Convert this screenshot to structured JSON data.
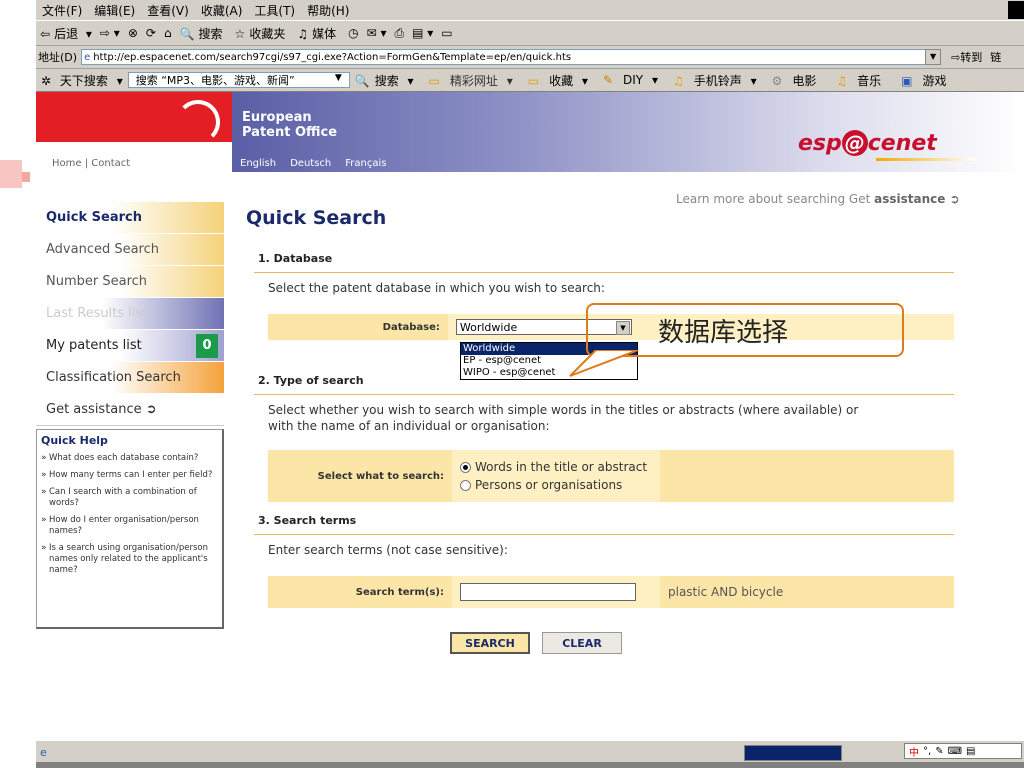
{
  "menubar": {
    "items": [
      "文件(F)",
      "编辑(E)",
      "查看(V)",
      "收藏(A)",
      "工具(T)",
      "帮助(H)"
    ]
  },
  "toolbar": {
    "back": "后退",
    "search": "搜索",
    "favorites": "收藏夹",
    "media": "媒体"
  },
  "address": {
    "label": "地址(D)",
    "url": "http://ep.espacenet.com/search97cgi/s97_cgi.exe?Action=FormGen&Template=ep/en/quick.hts",
    "go": "转到",
    "links": "链"
  },
  "searchbar": {
    "label": "天下搜索",
    "query": "搜索 “MP3、电影、游戏、新闻”",
    "search": "搜索",
    "sites": "精彩网址",
    "favorites": "收藏",
    "diy": "DIY",
    "ringtones": "手机铃声",
    "movies": "电影",
    "music": "音乐",
    "games": "游戏"
  },
  "header": {
    "org_line1": "European",
    "org_line2": "Patent Office",
    "home_links": "Home | Contact",
    "langs": [
      "English",
      "Deutsch",
      "Français"
    ],
    "logo_pre": "esp",
    "logo_at": "@",
    "logo_post": "cenet"
  },
  "sidebar": {
    "items": [
      {
        "label": "Quick Search"
      },
      {
        "label": "Advanced Search"
      },
      {
        "label": "Number Search"
      },
      {
        "label": "Last Results list"
      },
      {
        "label": "My patents list",
        "badge": "0"
      },
      {
        "label": "Classification Search"
      },
      {
        "label": "Get assistance ➲"
      }
    ],
    "quick_help": {
      "title": "Quick Help",
      "items": [
        "What does each database contain?",
        "How many terms can I enter per field?",
        "Can I search with a combination of words?",
        "How do I enter organisation/person names?",
        "Is a search using organisation/person names only related to the applicant's name?"
      ]
    }
  },
  "main": {
    "learn_more": "Learn more about searching Get ",
    "learn_more_bold": "assistance ➲",
    "title": "Quick Search",
    "sec1": {
      "heading": "1. Database",
      "desc": "Select the patent database in which you wish to search:",
      "label": "Database:",
      "selected": "Worldwide",
      "options": [
        "Worldwide",
        "EP - esp@cenet",
        "WIPO - esp@cenet"
      ]
    },
    "callout": "数据库选择",
    "sec2": {
      "heading": "2. Type of search",
      "desc1": "Select whether you wish to search with simple words in the titles or abstracts (where available) or",
      "desc2": "with the name of an individual or organisation:",
      "label": "Select what to search:",
      "option1": "Words in the title or abstract",
      "option2": "Persons or organisations"
    },
    "sec3": {
      "heading": "3. Search terms",
      "desc": "Enter search terms (not case sensitive):",
      "label": "Search term(s):",
      "value": "",
      "example": "plastic AND bicycle"
    },
    "buttons": {
      "search": "SEARCH",
      "clear": "CLEAR"
    }
  },
  "status": {
    "progress": 1.0
  }
}
